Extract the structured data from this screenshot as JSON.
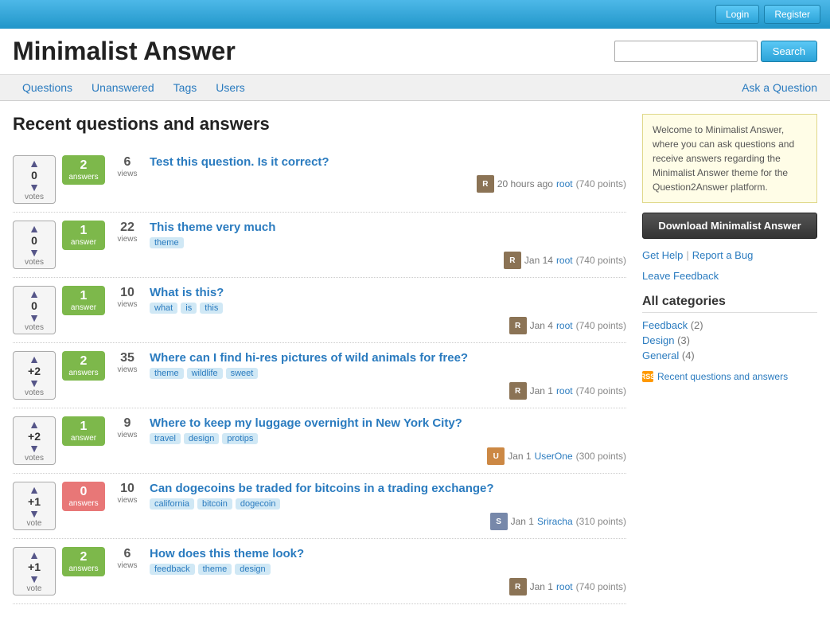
{
  "topbar": {
    "login_label": "Login",
    "register_label": "Register"
  },
  "header": {
    "site_title": "Minimalist Answer",
    "search_placeholder": "",
    "search_btn_label": "Search"
  },
  "nav": {
    "links": [
      {
        "label": "Questions",
        "id": "questions"
      },
      {
        "label": "Unanswered",
        "id": "unanswered"
      },
      {
        "label": "Tags",
        "id": "tags"
      },
      {
        "label": "Users",
        "id": "users"
      }
    ],
    "ask_label": "Ask a Question"
  },
  "main": {
    "page_heading": "Recent questions and answers"
  },
  "questions": [
    {
      "votes": "0",
      "votes_label": "votes",
      "answers": "2",
      "answers_label": "answers",
      "has_answers": true,
      "views": "6",
      "views_label": "views",
      "title": "Test this question. Is it correct?",
      "tags": [],
      "meta_time": "20 hours ago",
      "meta_user": "root",
      "meta_points": "(740 points)",
      "avatar_color": "#8B7355",
      "avatar_letter": "R"
    },
    {
      "votes": "0",
      "votes_label": "votes",
      "answers": "1",
      "answers_label": "answer",
      "has_answers": true,
      "views": "22",
      "views_label": "views",
      "title": "This theme very much",
      "tags": [
        "theme"
      ],
      "meta_time": "Jan 14",
      "meta_user": "root",
      "meta_points": "(740 points)",
      "avatar_color": "#8B7355",
      "avatar_letter": "R"
    },
    {
      "votes": "0",
      "votes_label": "votes",
      "answers": "1",
      "answers_label": "answer",
      "has_answers": true,
      "views": "10",
      "views_label": "views",
      "title": "What is this?",
      "tags": [
        "what",
        "is",
        "this"
      ],
      "meta_time": "Jan 4",
      "meta_user": "root",
      "meta_points": "(740 points)",
      "avatar_color": "#8B7355",
      "avatar_letter": "R"
    },
    {
      "votes": "+2",
      "votes_label": "votes",
      "answers": "2",
      "answers_label": "answers",
      "has_answers": true,
      "views": "35",
      "views_label": "views",
      "title": "Where can I find hi-res pictures of wild animals for free?",
      "tags": [
        "theme",
        "wildlife",
        "sweet"
      ],
      "meta_time": "Jan 1",
      "meta_user": "root",
      "meta_points": "(740 points)",
      "avatar_color": "#8B7355",
      "avatar_letter": "R"
    },
    {
      "votes": "+2",
      "votes_label": "votes",
      "answers": "1",
      "answers_label": "answer",
      "has_answers": true,
      "views": "9",
      "views_label": "views",
      "title": "Where to keep my luggage overnight in New York City?",
      "tags": [
        "travel",
        "design",
        "protips"
      ],
      "meta_time": "Jan 1",
      "meta_user": "UserOne",
      "meta_points": "(300 points)",
      "avatar_color": "#cc8844",
      "avatar_letter": "U"
    },
    {
      "votes": "+1",
      "votes_label": "vote",
      "answers": "0",
      "answers_label": "answers",
      "has_answers": false,
      "views": "10",
      "views_label": "views",
      "title": "Can dogecoins be traded for bitcoins in a trading exchange?",
      "tags": [
        "california",
        "bitcoin",
        "dogecoin"
      ],
      "meta_time": "Jan 1",
      "meta_user": "Sriracha",
      "meta_points": "(310 points)",
      "avatar_color": "#7788aa",
      "avatar_letter": "S"
    },
    {
      "votes": "+1",
      "votes_label": "vote",
      "answers": "2",
      "answers_label": "answers",
      "has_answers": true,
      "views": "6",
      "views_label": "views",
      "title": "How does this theme look?",
      "tags": [
        "feedback",
        "theme",
        "design"
      ],
      "meta_time": "Jan 1",
      "meta_user": "root",
      "meta_points": "(740 points)",
      "avatar_color": "#8B7355",
      "avatar_letter": "R"
    }
  ],
  "sidebar": {
    "welcome_text": "Welcome to Minimalist Answer, where you can ask questions and receive answers regarding the Minimalist Answer theme for the Question2Answer platform.",
    "download_label": "Download Minimalist Answer",
    "get_help_label": "Get Help",
    "report_bug_label": "Report a Bug",
    "leave_feedback_label": "Leave Feedback",
    "all_categories_title": "All categories",
    "categories": [
      {
        "name": "Feedback",
        "count": "(2)"
      },
      {
        "name": "Design",
        "count": "(3)"
      },
      {
        "name": "General",
        "count": "(4)"
      }
    ],
    "rss_label": "Recent questions and answers"
  }
}
